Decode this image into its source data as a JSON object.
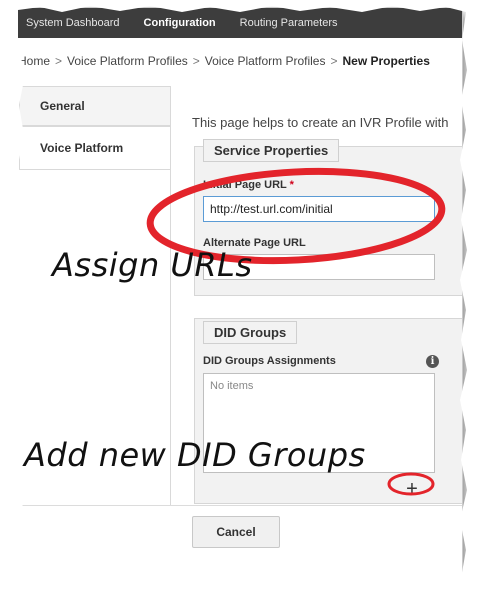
{
  "topnav": {
    "items": [
      {
        "label": "System Dashboard"
      },
      {
        "label": "Configuration"
      },
      {
        "label": "Routing Parameters"
      }
    ]
  },
  "breadcrumb": {
    "items": [
      "Home",
      "Voice Platform Profiles",
      "Voice Platform Profiles"
    ],
    "current": "New Properties",
    "separator": ">"
  },
  "sidebar": {
    "tabs": [
      {
        "label": "General"
      },
      {
        "label": "Voice Platform"
      }
    ]
  },
  "intro_text": "This page helps to create an IVR Profile with",
  "service_properties": {
    "legend": "Service Properties",
    "initial_url_label": "Initial Page URL",
    "required_mark": "*",
    "initial_url_value": "http://test.url.com/initial",
    "alternate_url_label": "Alternate Page URL",
    "alternate_url_value": ""
  },
  "did_groups": {
    "legend": "DID Groups",
    "assignments_label": "DID Groups Assignments",
    "info_glyph": "i",
    "empty_text": "No items",
    "add_glyph": "+"
  },
  "footer": {
    "cancel_label": "Cancel"
  },
  "annotations": {
    "assign_urls": "Assign URLs",
    "add_did": "Add new DID Groups",
    "highlight_color": "#e3242b"
  }
}
